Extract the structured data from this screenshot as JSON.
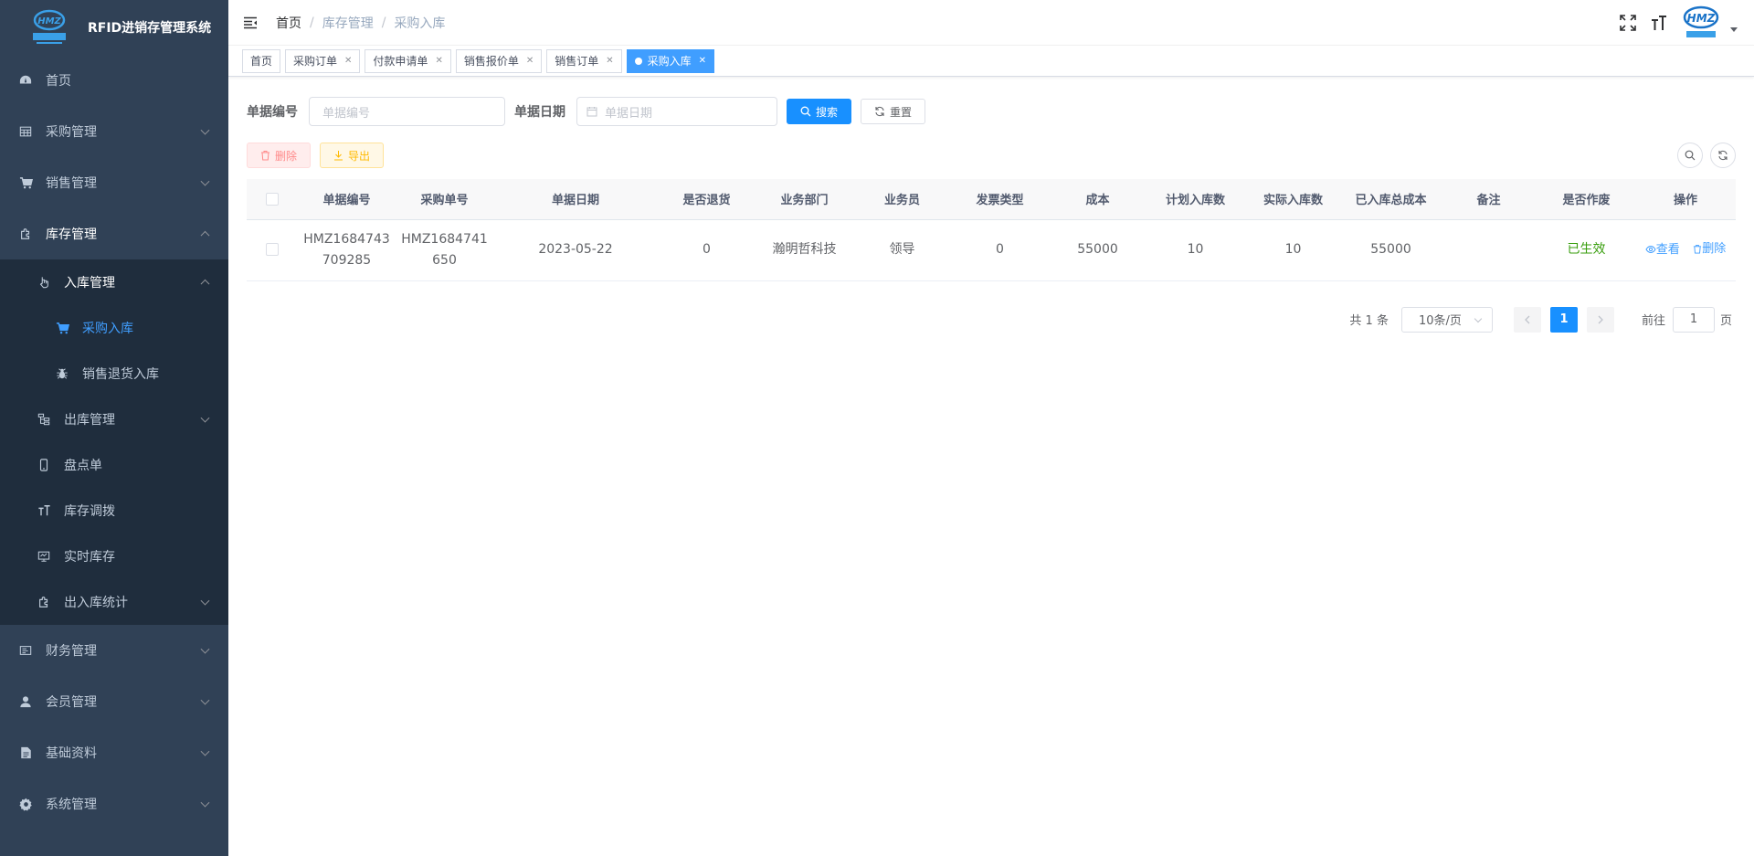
{
  "app": {
    "title": "RFID进销存管理系统",
    "logo_text": "HMZ"
  },
  "sidebar": {
    "items": [
      {
        "label": "首页",
        "icon": "dashboard-icon"
      },
      {
        "label": "采购管理",
        "icon": "table-icon"
      },
      {
        "label": "销售管理",
        "icon": "shopping-cart-icon"
      },
      {
        "label": "库存管理",
        "icon": "puzzle-icon"
      },
      {
        "label": "入库管理",
        "icon": "hand-pointer-icon"
      },
      {
        "label": "采购入库",
        "icon": "shopping-cart-icon"
      },
      {
        "label": "销售退货入库",
        "icon": "bug-icon"
      },
      {
        "label": "出库管理",
        "icon": "tree-icon"
      },
      {
        "label": "盘点单",
        "icon": "phone-icon"
      },
      {
        "label": "库存调拨",
        "icon": "font-size-icon"
      },
      {
        "label": "实时库存",
        "icon": "monitor-icon"
      },
      {
        "label": "出入库统计",
        "icon": "puzzle-icon"
      },
      {
        "label": "财务管理",
        "icon": "finance-icon"
      },
      {
        "label": "会员管理",
        "icon": "user-icon"
      },
      {
        "label": "基础资料",
        "icon": "document-icon"
      },
      {
        "label": "系统管理",
        "icon": "gear-icon"
      }
    ]
  },
  "breadcrumb": [
    "首页",
    "库存管理",
    "采购入库"
  ],
  "tabs": [
    {
      "label": "首页"
    },
    {
      "label": "采购订单"
    },
    {
      "label": "付款申请单"
    },
    {
      "label": "销售报价单"
    },
    {
      "label": "销售订单"
    },
    {
      "label": "采购入库"
    }
  ],
  "search": {
    "doc_no_label": "单据编号",
    "doc_no_placeholder": "单据编号",
    "doc_date_label": "单据日期",
    "doc_date_placeholder": "单据日期",
    "search_btn": "搜索",
    "reset_btn": "重置"
  },
  "toolbar": {
    "delete_btn": "删除",
    "export_btn": "导出"
  },
  "table": {
    "headers": [
      "单据编号",
      "采购单号",
      "单据日期",
      "是否退货",
      "业务部门",
      "业务员",
      "发票类型",
      "成本",
      "计划入库数",
      "实际入库数",
      "已入库总成本",
      "备注",
      "是否作废",
      "操作"
    ],
    "rows": [
      {
        "doc_no_l1": "HMZ1684743",
        "doc_no_l2": "709285",
        "po_no_l1": "HMZ1684741",
        "po_no_l2": "650",
        "date": "2023-05-22",
        "is_return": "0",
        "dept": "瀚明哲科技",
        "salesman": "领导",
        "invoice_type": "0",
        "cost": "55000",
        "plan_qty": "10",
        "actual_qty": "10",
        "total_cost": "55000",
        "remark": "",
        "status": "已生效",
        "view": "查看",
        "delete": "删除"
      }
    ]
  },
  "pagination": {
    "total": "共 1 条",
    "page_size": "10条/页",
    "current": "1",
    "goto_label": "前往",
    "goto_value": "1",
    "page_suffix": "页"
  },
  "colors": {
    "sidebar_bg": "#304156",
    "primary": "#1890ff",
    "active_menu": "#409eff"
  }
}
